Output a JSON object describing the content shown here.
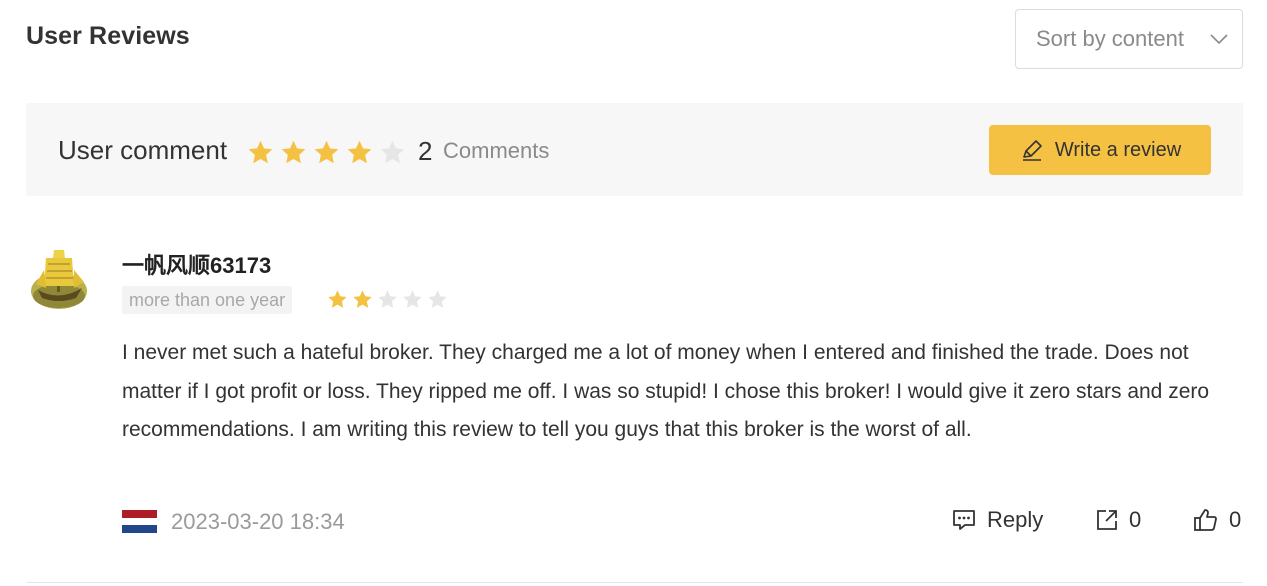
{
  "header": {
    "title": "User Reviews",
    "sort": {
      "selected": "Sort by content",
      "icon": "chevron-down-icon"
    }
  },
  "summary": {
    "label": "User comment",
    "rating": 4,
    "max_rating": 5,
    "count": "2",
    "count_label": "Comments",
    "write_button": {
      "label": "Write a review",
      "icon": "pen-icon"
    }
  },
  "review": {
    "username": "一帆风顺63173",
    "time_ago": "more than one year",
    "rating": 2,
    "max_rating": 5,
    "text": "I never met such a hateful broker. They charged me a lot of money when I entered and finished the trade. Does not matter if I got profit or loss. They ripped me off. I was so stupid! I chose this broker! I would give it zero stars and zero recommendations. I am writing this review to tell you guys that this broker is the worst of all.",
    "country_flag": "netherlands-flag",
    "date": "2023-03-20 18:34",
    "actions": {
      "reply_label": "Reply",
      "share_count": "0",
      "like_count": "0"
    }
  },
  "colors": {
    "star_filled": "#f5c143",
    "star_empty": "#e6e6e6",
    "accent": "#f5c143",
    "flag_red": "#ae1c28",
    "flag_white": "#ffffff",
    "flag_blue": "#21468b"
  }
}
